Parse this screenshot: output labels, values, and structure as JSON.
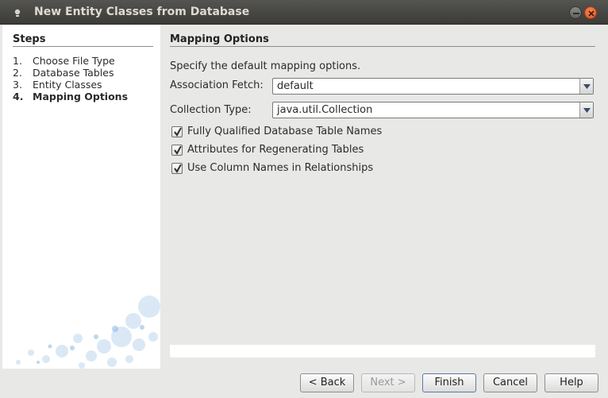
{
  "window": {
    "title": "New Entity Classes from Database",
    "colors": {
      "titlebar": "#3c3b37",
      "close_button": "#e0531f",
      "panel": "#e8e8e7"
    }
  },
  "steps": {
    "title": "Steps",
    "items": [
      {
        "num": "1.",
        "label": "Choose File Type"
      },
      {
        "num": "2.",
        "label": "Database Tables"
      },
      {
        "num": "3.",
        "label": "Entity Classes"
      },
      {
        "num": "4.",
        "label": "Mapping Options",
        "current": true
      }
    ]
  },
  "main": {
    "title": "Mapping Options",
    "description": "Specify the default mapping options.",
    "association_fetch": {
      "label": "Association Fetch:",
      "value": "default"
    },
    "collection_type": {
      "label": "Collection Type:",
      "value": "java.util.Collection"
    },
    "checkboxes": [
      {
        "label": "Fully Qualified Database Table Names",
        "checked": true
      },
      {
        "label": "Attributes for Regenerating Tables",
        "checked": true
      },
      {
        "label": "Use Column Names in Relationships",
        "checked": true
      }
    ]
  },
  "buttons": {
    "back": "< Back",
    "next": "Next >",
    "finish": "Finish",
    "cancel": "Cancel",
    "help": "Help"
  }
}
